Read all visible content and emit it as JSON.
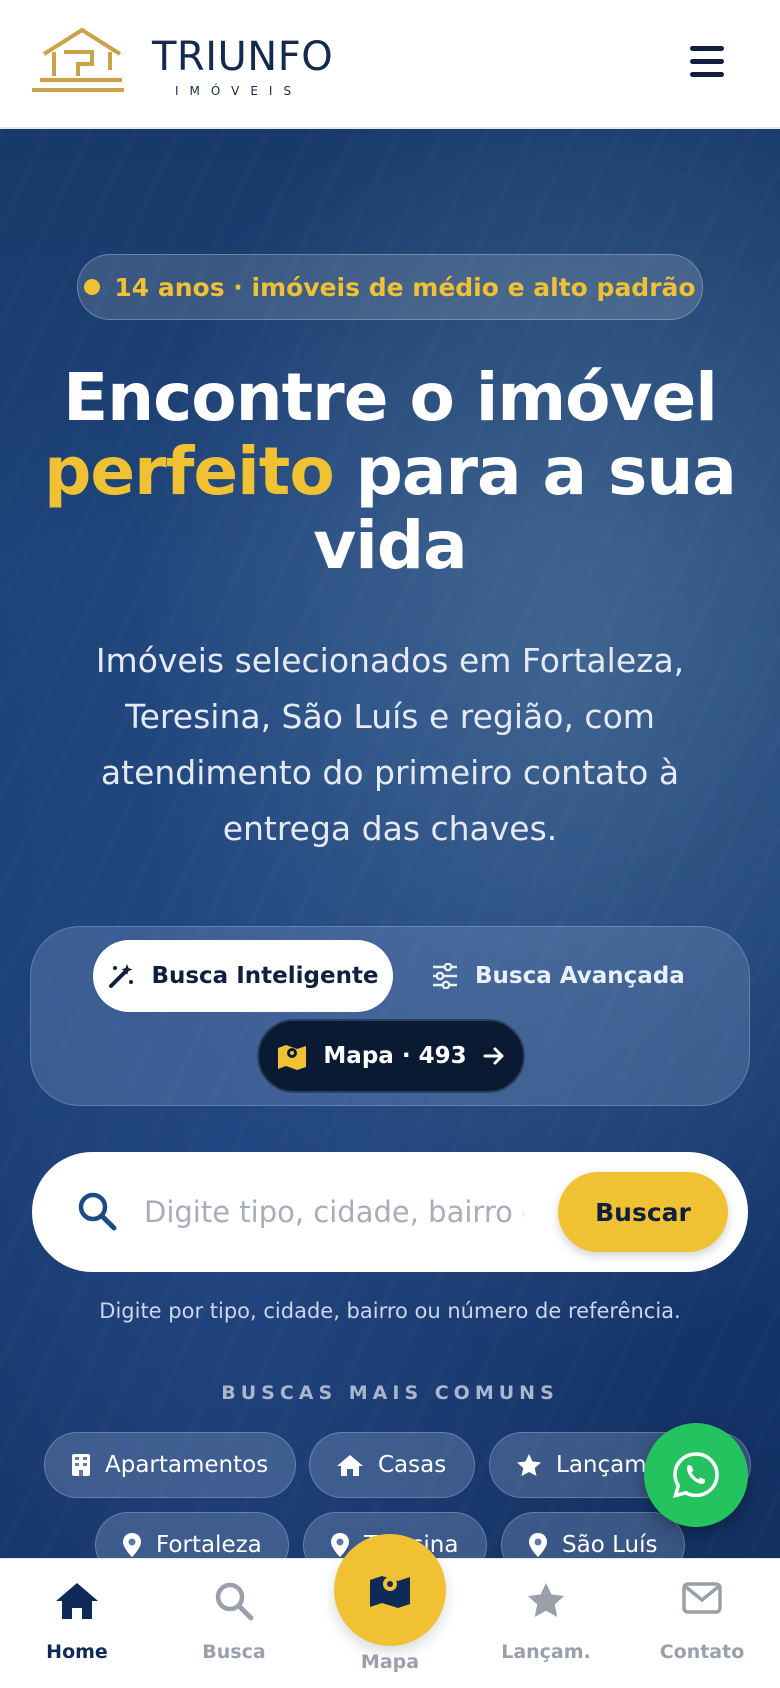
{
  "header": {
    "brand_name": "TRIUNFO",
    "brand_sub": "IMÓVEIS",
    "menu_icon": "hamburger-menu-icon"
  },
  "hero": {
    "badge_text": "14 anos · imóveis de médio e alto padrão",
    "headline_part1": "Encontre o imóvel",
    "headline_accent": "perfeito",
    "headline_part2": " para a sua vida",
    "subtitle": "Imóveis selecionados em Fortaleza, Teresina, São Luís e região, com atendimento do primeiro contato à entrega das chaves.",
    "colors": {
      "accent": "#f0c233",
      "primary_dark": "#0f2a57"
    }
  },
  "search_modes": {
    "smart_label": "Busca Inteligente",
    "advanced_label": "Busca Avançada",
    "map_label": "Mapa · 493"
  },
  "search": {
    "placeholder": "Digite tipo, cidade, bairro ou referência",
    "button_label": "Buscar",
    "help_text": "Digite por tipo, cidade, bairro ou número de referência."
  },
  "common_searches": {
    "title": "BUSCAS MAIS COMUNS",
    "chips": [
      {
        "label": "Apartamentos",
        "icon": "building-icon"
      },
      {
        "label": "Casas",
        "icon": "house-icon"
      },
      {
        "label": "Lançamentos",
        "icon": "star-icon"
      },
      {
        "label": "Fortaleza",
        "icon": "location-pin-icon"
      },
      {
        "label": "Teresina",
        "icon": "location-pin-icon"
      },
      {
        "label": "São Luís",
        "icon": "location-pin-icon"
      }
    ]
  },
  "bottom_nav": {
    "home": "Home",
    "busca": "Busca",
    "mapa": "Mapa",
    "lancamentos": "Lançam.",
    "contato": "Contato"
  }
}
